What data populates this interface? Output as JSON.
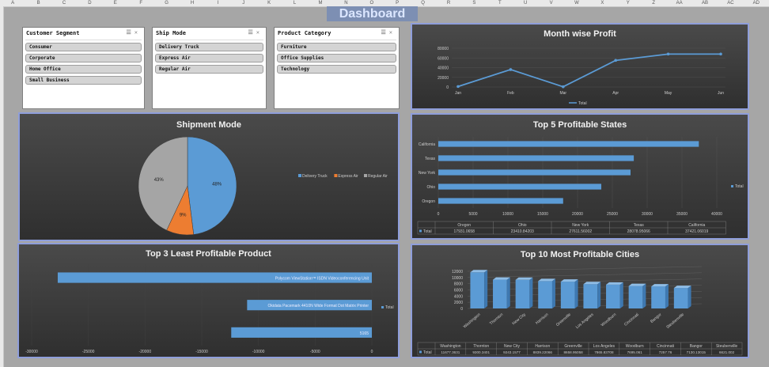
{
  "sheet": {
    "columns": [
      "A",
      "B",
      "C",
      "D",
      "E",
      "F",
      "G",
      "H",
      "I",
      "J",
      "K",
      "L",
      "M",
      "N",
      "O",
      "P",
      "Q",
      "R",
      "S",
      "T",
      "U",
      "V",
      "W",
      "X",
      "Y",
      "Z",
      "AA",
      "AB",
      "AC",
      "AD"
    ],
    "title": "Dashboard"
  },
  "slicers": [
    {
      "header": "Customer Segment",
      "items": [
        "Consumer",
        "Corporate",
        "Home Office",
        "Small Business"
      ]
    },
    {
      "header": "Ship Mode",
      "items": [
        "Delivery Truck",
        "Express Air",
        "Regular Air"
      ]
    },
    {
      "header": "Product Category",
      "items": [
        "Furniture",
        "Office Supplies",
        "Technology"
      ]
    }
  ],
  "panels": {
    "month": {
      "title": "Month wise Profit"
    },
    "shipment": {
      "title": "Shipment Mode"
    },
    "states": {
      "title": "Top 5 Profitable States"
    },
    "least": {
      "title": "Top 3 Least Profitable Product"
    },
    "cities": {
      "title": "Top 10 Most Profitable Cities"
    }
  },
  "chart_data": [
    {
      "id": "month",
      "type": "line",
      "title": "Month wise Profit",
      "categories": [
        "Jan",
        "Feb",
        "Mar",
        "Apr",
        "May",
        "Jun"
      ],
      "series": [
        {
          "name": "Total",
          "values": [
            1000,
            36000,
            500,
            55000,
            68000,
            68000
          ]
        }
      ],
      "yticks": [
        "80000",
        "60000",
        "40000",
        "20000",
        "0"
      ],
      "ylim": [
        0,
        80000
      ],
      "color": "#5b9bd5"
    },
    {
      "id": "shipment",
      "type": "pie",
      "title": "Shipment Mode",
      "categories": [
        "Delivery Truck",
        "Express Air",
        "Regular Air"
      ],
      "values": [
        48,
        9,
        43
      ],
      "labels": [
        "48%",
        "9%",
        "43%"
      ],
      "colors": [
        "#5b9bd5",
        "#ed7d31",
        "#a5a5a5"
      ]
    },
    {
      "id": "states",
      "type": "bar",
      "title": "Top 5 Profitable States",
      "categories": [
        "California",
        "Texas",
        "New York",
        "Ohio",
        "Oregon"
      ],
      "series": [
        {
          "name": "Total",
          "values": [
            37421.06019,
            28078.95066,
            27611.56002,
            23410.84203,
            17931.0658
          ]
        }
      ],
      "xticks": [
        "0",
        "5000",
        "10000",
        "15000",
        "20000",
        "25000",
        "30000",
        "35000",
        "40000"
      ],
      "xlim": [
        0,
        40000
      ],
      "table": {
        "header": [
          "Oregon",
          "Ohio",
          "New York",
          "Texas",
          "California"
        ],
        "row_label": "Total",
        "values": [
          "17931.0658",
          "23410.84203",
          "27611.56002",
          "28078.95066",
          "37421.06019"
        ]
      }
    },
    {
      "id": "least",
      "type": "bar",
      "title": "Top 3 Least Profitable Product",
      "categories": [
        "Polycom ViewStation™ ISDN Videoconferencing Unit",
        "Okidata Pacemark 4410N Wide Format Dot Matrix Printer",
        "5165"
      ],
      "series": [
        {
          "name": "Total",
          "values": [
            -27700,
            -11000,
            -12400
          ]
        }
      ],
      "xticks": [
        "-30000",
        "-25000",
        "-20000",
        "-15000",
        "-10000",
        "-5000",
        "0"
      ],
      "xlim": [
        -30000,
        0
      ]
    },
    {
      "id": "cities",
      "type": "bar",
      "title": "Top 10 Most Profitable Cities",
      "categories": [
        "Washington",
        "Thornton",
        "New City",
        "Harrison",
        "Greenville",
        "Los Angeles",
        "Woodburn",
        "Cincinnati",
        "Bangor",
        "Steubenville"
      ],
      "series": [
        {
          "name": "Total",
          "values": [
            11677.3631,
            9300.3401,
            9243.1577,
            8839.22066,
            8658.95058,
            7865.83708,
            7695.061,
            7257.76,
            7130.13015,
            6621.002
          ]
        }
      ],
      "yticks": [
        "12000",
        "10000",
        "8000",
        "6000",
        "4000",
        "2000",
        "0"
      ],
      "ylim": [
        0,
        12000
      ],
      "table": {
        "row_label": "Total",
        "values": [
          "11677.3631",
          "9300.3401",
          "9243.1577",
          "8839.22066",
          "8658.95058",
          "7865.83708",
          "7695.061",
          "7257.76",
          "7130.13015",
          "6621.002"
        ]
      }
    }
  ]
}
